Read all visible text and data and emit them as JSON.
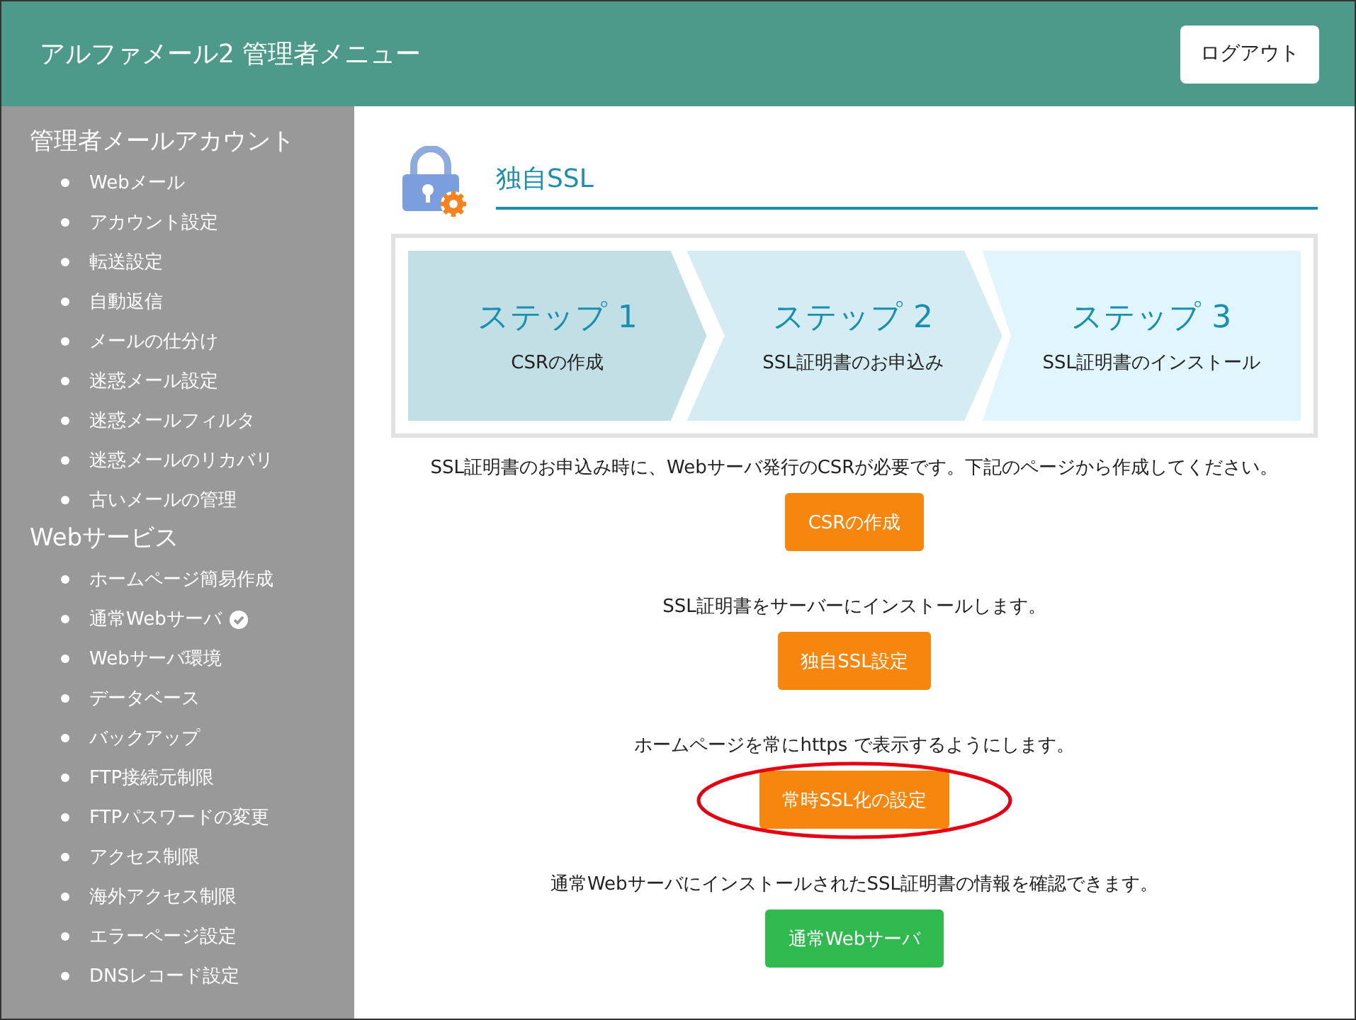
{
  "header": {
    "title": "アルファメール2 管理者メニュー",
    "logout": "ログアウト"
  },
  "sidebar": [
    {
      "heading": "管理者メールアカウント",
      "items": [
        {
          "label": "Webメール",
          "verified": false
        },
        {
          "label": "アカウント設定",
          "verified": false
        },
        {
          "label": "転送設定",
          "verified": false
        },
        {
          "label": "自動返信",
          "verified": false
        },
        {
          "label": "メールの仕分け",
          "verified": false
        },
        {
          "label": "迷惑メール設定",
          "verified": false
        },
        {
          "label": "迷惑メールフィルタ",
          "verified": false
        },
        {
          "label": "迷惑メールのリカバリ",
          "verified": false
        },
        {
          "label": "古いメールの管理",
          "verified": false
        }
      ]
    },
    {
      "heading": "Webサービス",
      "items": [
        {
          "label": "ホームページ簡易作成",
          "verified": false
        },
        {
          "label": "通常Webサーバ",
          "verified": true
        },
        {
          "label": "Webサーバ環境",
          "verified": false
        },
        {
          "label": "データベース",
          "verified": false
        },
        {
          "label": "バックアップ",
          "verified": false
        },
        {
          "label": "FTP接続元制限",
          "verified": false
        },
        {
          "label": "FTPパスワードの変更",
          "verified": false
        },
        {
          "label": "アクセス制限",
          "verified": false
        },
        {
          "label": "海外アクセス制限",
          "verified": false
        },
        {
          "label": "エラーページ設定",
          "verified": false
        },
        {
          "label": "DNSレコード設定",
          "verified": false
        }
      ]
    }
  ],
  "page_title": "独自SSL",
  "steps": [
    {
      "title": "ステップ 1",
      "caption": "CSRの作成",
      "color": "#c2dfe6"
    },
    {
      "title": "ステップ 2",
      "caption": "SSL証明書のお申込み",
      "color": "#d4ecf2"
    },
    {
      "title": "ステップ 3",
      "caption": "SSL証明書のインストール",
      "color": "#e0f6fc"
    }
  ],
  "actions": [
    {
      "text": "SSL証明書のお申込み時に、Webサーバ発行のCSRが必要です。下記のページから作成してください。",
      "button": "CSRの作成",
      "color": "#f7860f",
      "highlighted": false
    },
    {
      "text": "SSL証明書をサーバーにインストールします。",
      "button": "独自SSL設定",
      "color": "#f7860f",
      "highlighted": false
    },
    {
      "text": "ホームページを常にhttps で表示するようにします。",
      "button": "常時SSL化の設定",
      "color": "#f7860f",
      "highlighted": true
    },
    {
      "text": "通常WebサーバにインストールされたSSL証明書の情報を確認できます。",
      "button": "通常Webサーバ",
      "color": "#2fb94f",
      "highlighted": false
    }
  ]
}
